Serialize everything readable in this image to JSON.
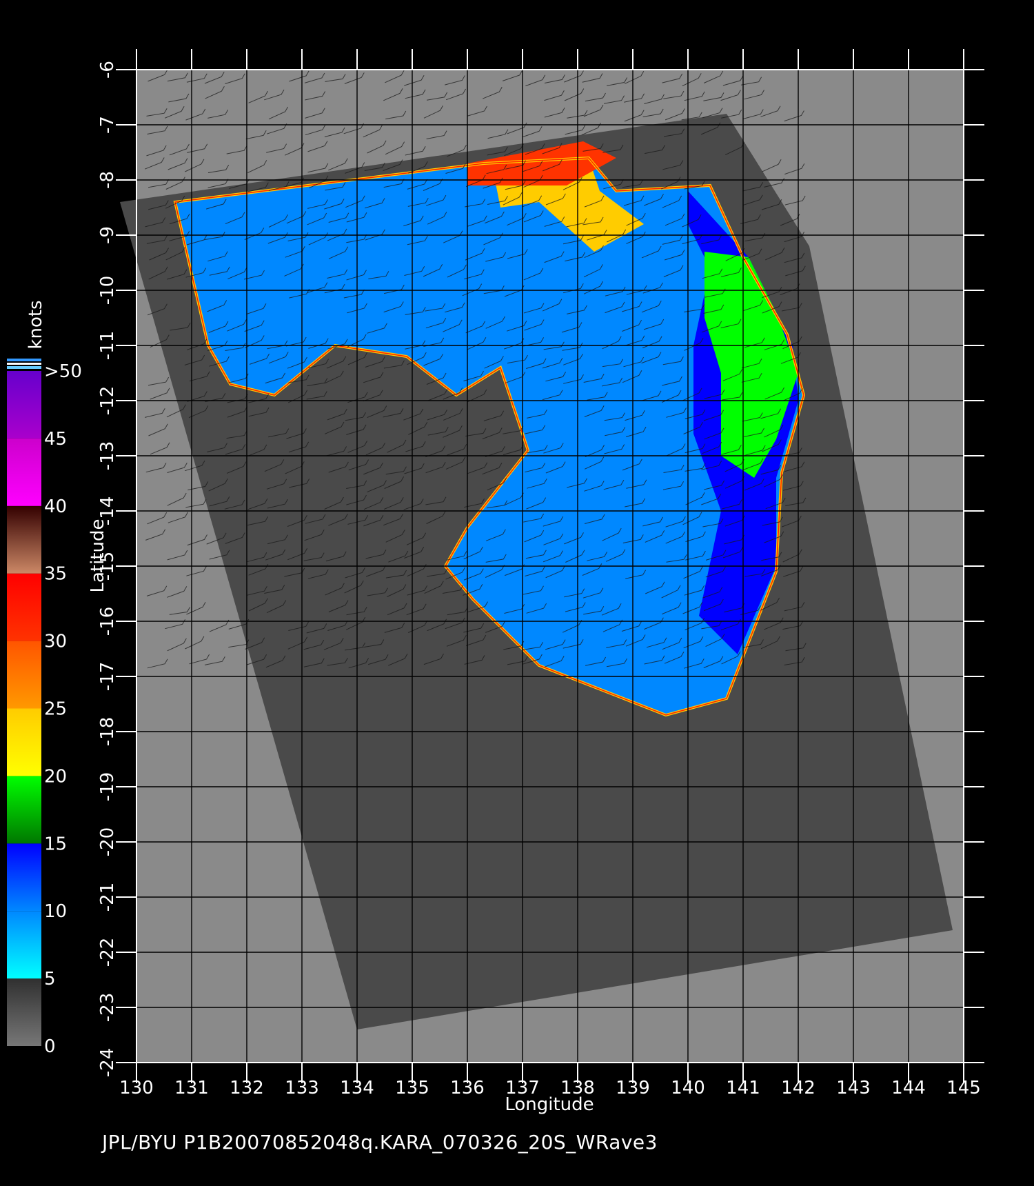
{
  "footer_text": "JPL/BYU  P1B20070852048q.KARA_070326_20S_WRave3",
  "chart_data": {
    "type": "heatmap",
    "title": "",
    "xlabel": "Longitude",
    "ylabel": "Latitude",
    "xlim": [
      130,
      145
    ],
    "ylim": [
      -24,
      -6
    ],
    "grid": true,
    "x_ticks": [
      "130",
      "131",
      "132",
      "133",
      "134",
      "135",
      "136",
      "137",
      "138",
      "139",
      "140",
      "141",
      "142",
      "143",
      "144",
      "145"
    ],
    "y_ticks": [
      "-6",
      "-7",
      "-8",
      "-9",
      "-10",
      "-11",
      "-12",
      "-13",
      "-14",
      "-15",
      "-16",
      "-17",
      "-18",
      "-19",
      "-20",
      "-21",
      "-22",
      "-23",
      "-24"
    ],
    "colorbar": {
      "label": "knots",
      "tick_labels": [
        "0",
        "5",
        "10",
        "15",
        "20",
        "25",
        "30",
        "35",
        "40",
        "45",
        ">50"
      ],
      "bands": [
        {
          "from": 0,
          "to": 5,
          "colors": [
            "#777777",
            "#303030"
          ]
        },
        {
          "from": 5,
          "to": 10,
          "colors": [
            "#00ffff",
            "#0088ff"
          ]
        },
        {
          "from": 10,
          "to": 15,
          "colors": [
            "#0088ff",
            "#0000ff"
          ]
        },
        {
          "from": 15,
          "to": 20,
          "colors": [
            "#007700",
            "#00ff00"
          ]
        },
        {
          "from": 20,
          "to": 25,
          "colors": [
            "#ffff00",
            "#ffcc00"
          ]
        },
        {
          "from": 25,
          "to": 30,
          "colors": [
            "#ff9900",
            "#ff5500"
          ]
        },
        {
          "from": 30,
          "to": 35,
          "colors": [
            "#ff3300",
            "#ff0000"
          ]
        },
        {
          "from": 35,
          "to": 40,
          "colors": [
            "#cc8866",
            "#330000"
          ]
        },
        {
          "from": 40,
          "to": 45,
          "colors": [
            "#ff00ff",
            "#cc00cc"
          ]
        },
        {
          "from": 45,
          "to": 50,
          "colors": [
            "#aa00cc",
            "#6600cc"
          ]
        }
      ]
    },
    "swath_no_data_region": [
      [
        134.0,
        -23.4
      ],
      [
        129.7,
        -8.4
      ],
      [
        140.7,
        -6.8
      ],
      [
        142.2,
        -9.2
      ],
      [
        144.8,
        -21.6
      ]
    ],
    "wind_speed_regions": [
      {
        "name": "moderate-winds-cyan",
        "speed_knots": 8,
        "polygon": [
          [
            130.7,
            -8.4
          ],
          [
            136.3,
            -7.7
          ],
          [
            138.2,
            -7.6
          ],
          [
            138.7,
            -8.2
          ],
          [
            140.4,
            -8.1
          ],
          [
            141.0,
            -9.4
          ],
          [
            141.8,
            -10.8
          ],
          [
            142.1,
            -11.9
          ],
          [
            141.7,
            -13.3
          ],
          [
            141.6,
            -15.1
          ],
          [
            140.7,
            -17.4
          ],
          [
            139.6,
            -17.7
          ],
          [
            137.3,
            -16.8
          ],
          [
            136.1,
            -15.6
          ],
          [
            135.6,
            -15.0
          ],
          [
            136.0,
            -14.3
          ],
          [
            137.1,
            -12.9
          ],
          [
            136.6,
            -11.4
          ],
          [
            135.8,
            -11.9
          ],
          [
            134.9,
            -11.2
          ],
          [
            133.6,
            -11.0
          ],
          [
            132.5,
            -11.9
          ],
          [
            131.7,
            -11.7
          ],
          [
            131.3,
            -11.0
          ]
        ]
      },
      {
        "name": "fresh-winds-blue",
        "speed_knots": 13,
        "polygon": [
          [
            140.0,
            -8.2
          ],
          [
            141.1,
            -9.4
          ],
          [
            141.9,
            -11.0
          ],
          [
            142.0,
            -12.0
          ],
          [
            141.6,
            -13.4
          ],
          [
            141.6,
            -15.0
          ],
          [
            140.9,
            -16.6
          ],
          [
            140.2,
            -15.9
          ],
          [
            140.6,
            -14.0
          ],
          [
            140.1,
            -12.6
          ],
          [
            140.1,
            -11.0
          ],
          [
            140.4,
            -9.6
          ],
          [
            140.0,
            -8.8
          ]
        ]
      },
      {
        "name": "strong-winds-green",
        "speed_knots": 18,
        "polygon": [
          [
            140.3,
            -9.3
          ],
          [
            141.1,
            -9.4
          ],
          [
            141.6,
            -10.4
          ],
          [
            142.0,
            -11.5
          ],
          [
            141.6,
            -12.7
          ],
          [
            141.2,
            -13.4
          ],
          [
            140.6,
            -13.0
          ],
          [
            140.6,
            -11.5
          ],
          [
            140.3,
            -10.5
          ]
        ]
      },
      {
        "name": "gale-winds-yellow",
        "speed_knots": 23,
        "polygon": [
          [
            136.5,
            -8.0
          ],
          [
            138.2,
            -7.6
          ],
          [
            138.4,
            -8.2
          ],
          [
            139.2,
            -8.8
          ],
          [
            138.3,
            -9.3
          ],
          [
            137.3,
            -8.4
          ],
          [
            136.6,
            -8.5
          ]
        ]
      },
      {
        "name": "storm-winds-red",
        "speed_knots": 32,
        "polygon": [
          [
            136.0,
            -7.7
          ],
          [
            138.1,
            -7.3
          ],
          [
            138.7,
            -7.6
          ],
          [
            137.8,
            -8.1
          ],
          [
            136.9,
            -8.1
          ],
          [
            136.0,
            -8.1
          ]
        ]
      }
    ],
    "wind_barb_area": {
      "lon": [
        130.0,
        142.0
      ],
      "lat": [
        -17.0,
        -6.2
      ]
    }
  }
}
